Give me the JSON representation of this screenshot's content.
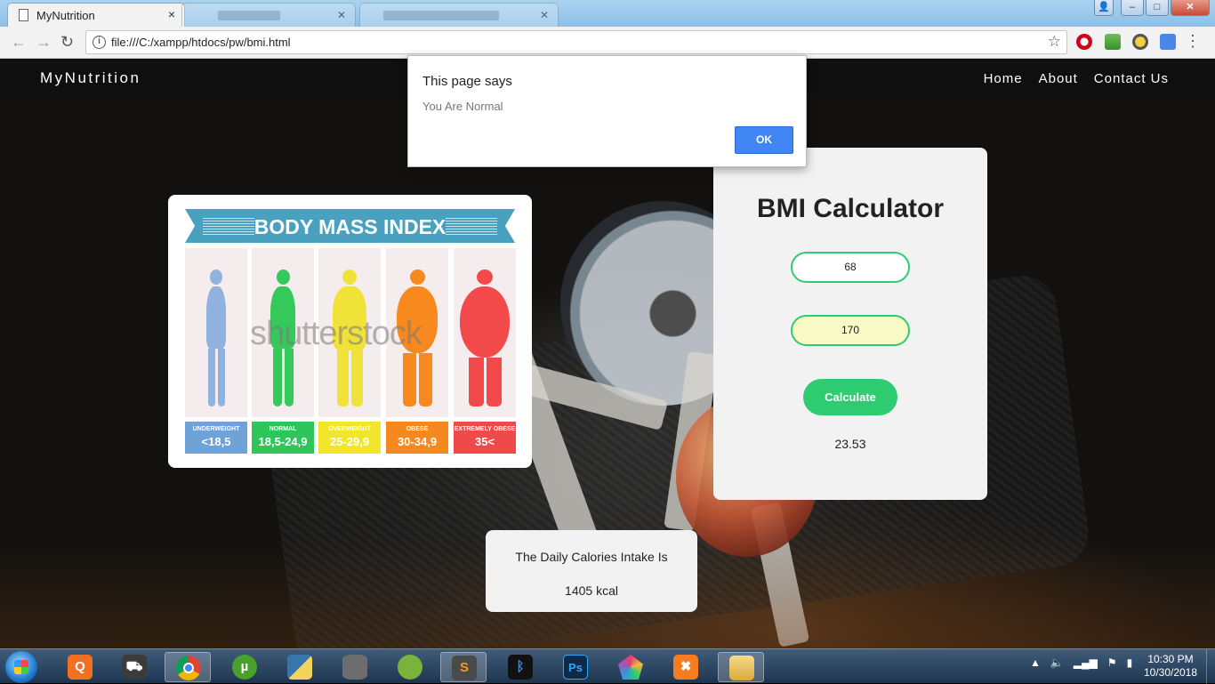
{
  "browser": {
    "tabs": [
      {
        "title": "MyNutrition",
        "close": "×"
      }
    ],
    "url": "file:///C:/xampp/htdocs/pw/bmi.html",
    "window_controls": {
      "minimize": "–",
      "maximize": "□",
      "close": "✕"
    }
  },
  "site": {
    "brand": "MyNutrition",
    "nav": [
      "Home",
      "About",
      "Contact Us"
    ]
  },
  "bmi_image": {
    "banner": "BODY MASS INDEX",
    "watermark": "shutterstock",
    "categories": [
      {
        "label": "UNDERWEIGHT",
        "range": "<18,5",
        "color": "#6fa2d6",
        "figure_color": "#8fb3de"
      },
      {
        "label": "NORMAL",
        "range": "18,5-24,9",
        "color": "#2ec55a",
        "figure_color": "#35c85a"
      },
      {
        "label": "OVERWEIGHT",
        "range": "25-29,9",
        "color": "#f2e52a",
        "figure_color": "#f1e23a"
      },
      {
        "label": "OBESE",
        "range": "30-34,9",
        "color": "#f5891e",
        "figure_color": "#f7891f"
      },
      {
        "label": "EXTREMELY OBESE",
        "range": "35<",
        "color": "#ef4a4a",
        "figure_color": "#f24a4a"
      }
    ]
  },
  "calculator": {
    "title": "BMI Calculator",
    "weight_value": "68",
    "height_value": "170",
    "button": "Calculate",
    "result": "23.53",
    "accent_color": "#2ecc71"
  },
  "calories": {
    "title": "The Daily Calories Intake Is",
    "value": "1405 kcal"
  },
  "dialog": {
    "title": "This page says",
    "message": "You Are Normal",
    "ok": "OK"
  },
  "taskbar": {
    "time": "10:30 PM",
    "date": "10/30/2018",
    "apps": [
      {
        "name": "Q",
        "color": "#f36f21"
      },
      {
        "name": "",
        "color": "#3b3b3b"
      },
      {
        "name": "",
        "color": "#ddd"
      },
      {
        "name": "µ",
        "color": "#4aa02c"
      },
      {
        "name": "",
        "color": "#f2d35c"
      },
      {
        "name": "",
        "color": "#6d6d6d"
      },
      {
        "name": "",
        "color": "#79b33b"
      },
      {
        "name": "S",
        "color": "#4a4a4a"
      },
      {
        "name": "",
        "color": "#111"
      },
      {
        "name": "Ps",
        "color": "#0c2a4a"
      },
      {
        "name": "",
        "color": "#ec3c6f"
      },
      {
        "name": "",
        "color": "#f57d20"
      },
      {
        "name": "",
        "color": "#e6c46a"
      }
    ]
  }
}
